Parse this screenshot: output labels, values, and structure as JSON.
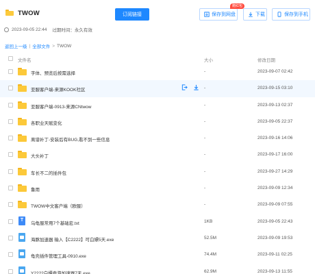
{
  "header": {
    "title": "TWOW",
    "subscribe_label": "订阅链接",
    "save_cloud_label": "保存到网盘",
    "download_label": "下载",
    "save_phone_label": "保存到手机",
    "badge": "赠红包",
    "created": "2023-09-05 22:44",
    "expire_label": "过期时间：永久有效"
  },
  "breadcrumb": {
    "back": "返回上一级",
    "sep": "|",
    "all": "全部文件",
    "arrow": ">",
    "current": "TWOW"
  },
  "table": {
    "col_name": "文件名",
    "col_size": "大小",
    "col_date": "修改日期",
    "rows": [
      {
        "icon": "folder",
        "name": "字体、预览后按需选择",
        "size": "-",
        "date": "2023-09-07 02:42"
      },
      {
        "icon": "folder",
        "name": "亚服客户端-来源KOOK社区",
        "size": "-",
        "date": "2023-09-15 03:10"
      },
      {
        "icon": "folder",
        "name": "亚服客户端-0913-来源CNtwow",
        "size": "-",
        "date": "2023-09-13 02:37"
      },
      {
        "icon": "folder",
        "name": "各职业天赋变化",
        "size": "-",
        "date": "2023-09-05 22:37"
      },
      {
        "icon": "folder",
        "name": "离谱补丁-安装后有BUG,看不到一些信息",
        "size": "-",
        "date": "2023-09-16 14:06"
      },
      {
        "icon": "folder",
        "name": "大头补丁",
        "size": "-",
        "date": "2023-09-17 16:00"
      },
      {
        "icon": "folder",
        "name": "车长不二的插件包",
        "size": "-",
        "date": "2023-09-27 14:29"
      },
      {
        "icon": "folder",
        "name": "鲁用",
        "size": "-",
        "date": "2023-09-09 12:34"
      },
      {
        "icon": "folder",
        "name": "TWOW中文客户端（欧服）",
        "size": "-",
        "date": "2023-09-09 07:55"
      },
      {
        "icon": "doc",
        "name": "乌龟服常用7个基础宏.txt",
        "size": "1KB",
        "date": "2023-09-05 22:43"
      },
      {
        "icon": "exe",
        "name": "海豚加速器 输入【C2222】可白嫖5天.exe",
        "size": "52.5M",
        "date": "2023-09-09 19:53"
      },
      {
        "icon": "exe",
        "name": "龟壳插件管理工具-0910.exe",
        "size": "74.4M",
        "date": "2023-09-11 02:25"
      },
      {
        "icon": "exe",
        "name": "Y2222白嫖奇游加速器7天.exe",
        "size": "62.9M",
        "date": "2023-09-13 11:55"
      }
    ]
  },
  "colors": {
    "accent": "#1e88ff",
    "folder": "#fcc93a",
    "badge": "#ff4b3e"
  }
}
